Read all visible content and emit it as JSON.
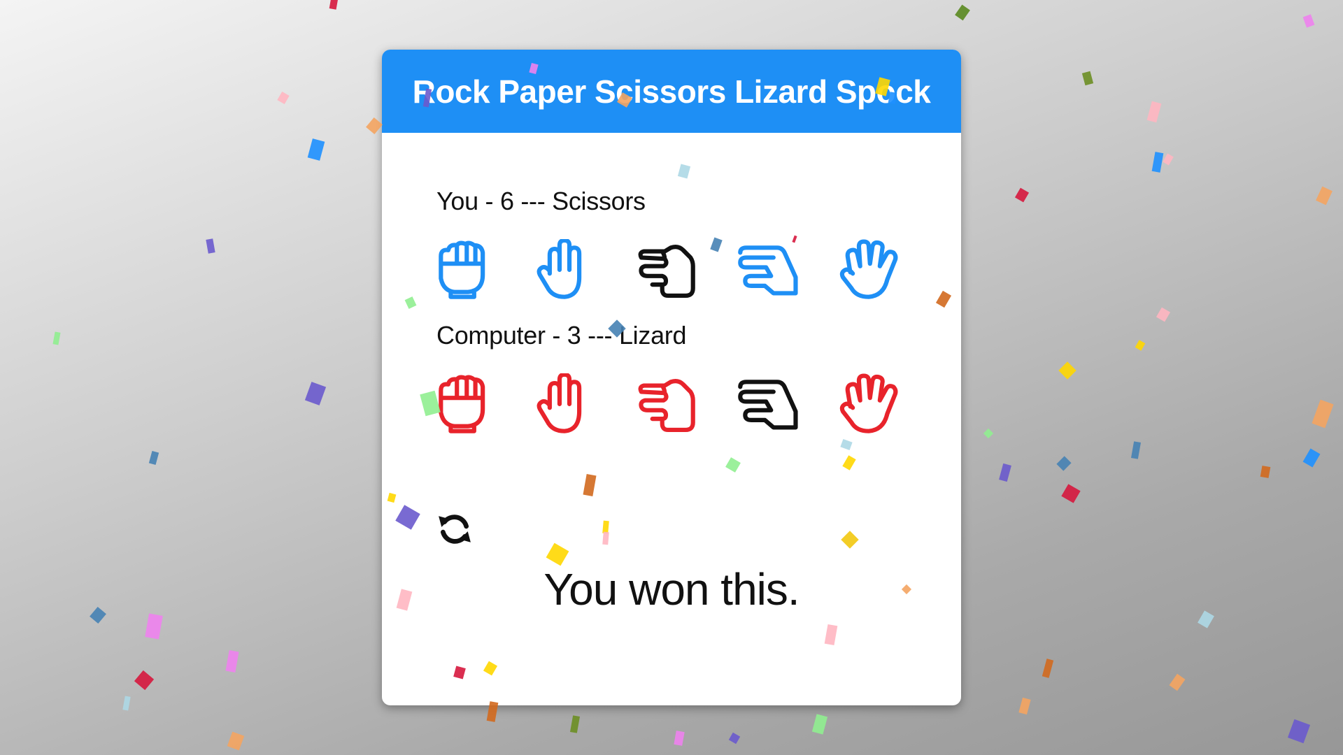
{
  "header": {
    "title": "Rock Paper Scissors Lizard Spock"
  },
  "player": {
    "label": "You - 6 --- Scissors",
    "score": 6,
    "choice": "Scissors",
    "color": "#1e8ff5"
  },
  "computer": {
    "label": "Computer - 3 --- Lizard",
    "score": 3,
    "choice": "Lizard",
    "color": "#e8232b"
  },
  "choices": [
    {
      "name": "Rock",
      "icon": "hand-rock-icon"
    },
    {
      "name": "Paper",
      "icon": "hand-paper-icon"
    },
    {
      "name": "Scissors",
      "icon": "hand-scissors-icon"
    },
    {
      "name": "Lizard",
      "icon": "hand-lizard-icon"
    },
    {
      "name": "Spock",
      "icon": "hand-spock-icon"
    }
  ],
  "reset": {
    "icon": "refresh-icon"
  },
  "result": {
    "message": "You won this."
  },
  "theme": {
    "header_bg": "#1e8ff5",
    "selected_color": "#111111"
  }
}
